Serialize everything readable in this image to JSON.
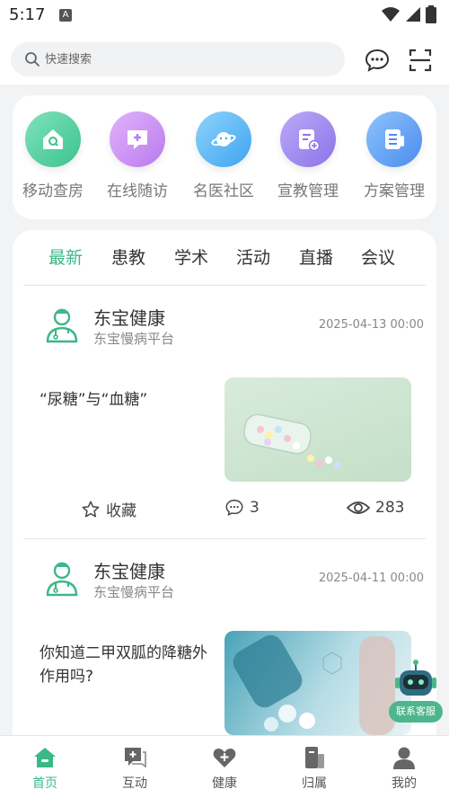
{
  "status": {
    "time": "5:17"
  },
  "search": {
    "placeholder": "快速搜索"
  },
  "quick": [
    {
      "label": "移动查房",
      "icon": "house-search-icon",
      "color": "#4fcf9c"
    },
    {
      "label": "在线随访",
      "icon": "chat-plus-icon",
      "color": "#c98bf0"
    },
    {
      "label": "名医社区",
      "icon": "planet-icon",
      "color": "#5bb5f5"
    },
    {
      "label": "宣教管理",
      "icon": "document-add-icon",
      "color": "#9a86ec"
    },
    {
      "label": "方案管理",
      "icon": "plan-document-icon",
      "color": "#5b9cf0"
    }
  ],
  "tabs": [
    "最新",
    "患教",
    "学术",
    "活动",
    "直播",
    "会议"
  ],
  "articles": [
    {
      "author": "东宝健康",
      "platform": "东宝慢病平台",
      "date": "2025-04-13 00:00",
      "title": "“尿糖”与“血糖”",
      "favorite_label": "收藏",
      "comments": "3",
      "views": "283"
    },
    {
      "author": "东宝健康",
      "platform": "东宝慢病平台",
      "date": "2025-04-11 00:00",
      "title": "你知道二甲双胍的降糖外作用吗?"
    }
  ],
  "service": {
    "label": "联系客服"
  },
  "nav": [
    {
      "label": "首页",
      "icon": "home-icon"
    },
    {
      "label": "互动",
      "icon": "interaction-icon"
    },
    {
      "label": "健康",
      "icon": "health-heart-icon"
    },
    {
      "label": "归属",
      "icon": "affiliation-icon"
    },
    {
      "label": "我的",
      "icon": "profile-icon"
    }
  ],
  "colors": {
    "accent": "#3bb887",
    "service": "#4cb68c"
  }
}
